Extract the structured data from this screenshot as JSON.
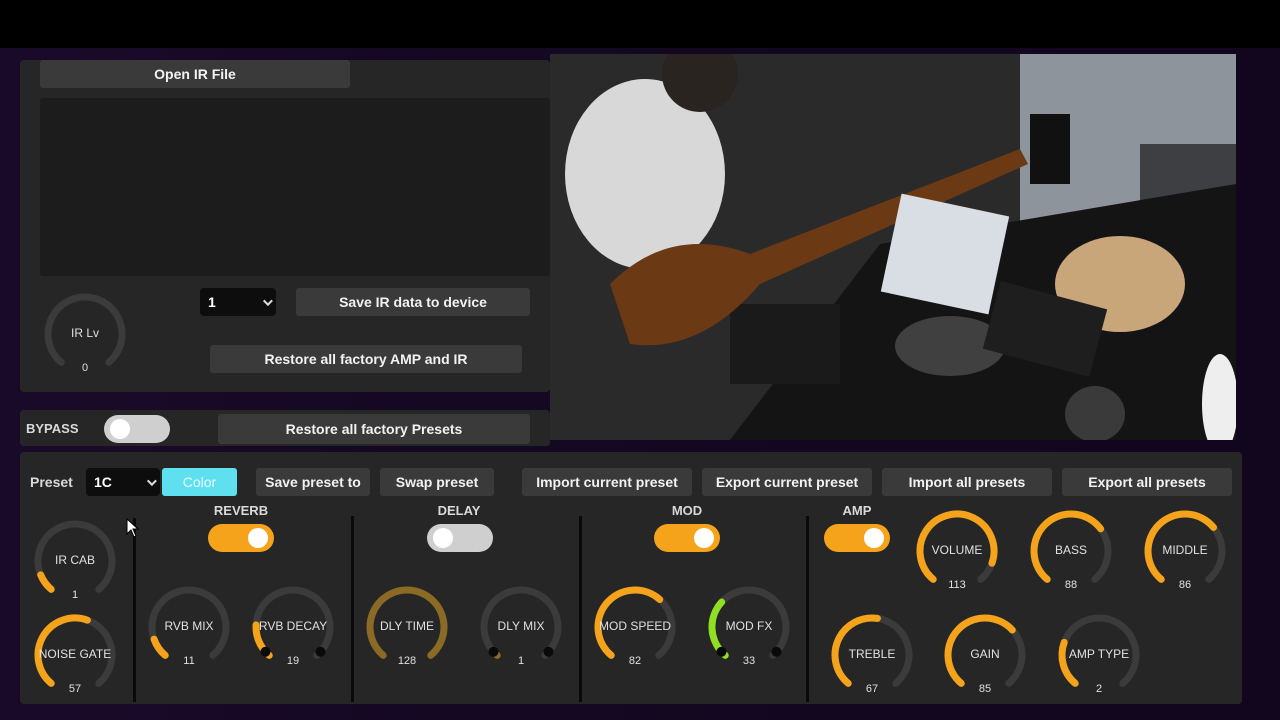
{
  "ir_panel": {
    "open_ir_file": "Open IR File",
    "ir_lv_label": "IR Lv",
    "ir_lv_value": "0",
    "ir_lv_level": 0,
    "slot_select": "1",
    "save_ir": "Save IR data to device",
    "restore_amp_ir": "Restore all factory AMP and IR"
  },
  "bypass": {
    "label": "BYPASS",
    "on": false,
    "restore_presets": "Restore all factory Presets"
  },
  "toolbar": {
    "preset_label": "Preset",
    "preset_value": "1C",
    "color_button": "Color",
    "save_preset": "Save preset to",
    "swap_preset": "Swap preset",
    "import_current": "Import current preset",
    "export_current": "Export current preset",
    "import_all": "Import all presets",
    "export_all": "Export all presets"
  },
  "sections": {
    "reverb": {
      "title": "REVERB",
      "on": true
    },
    "delay": {
      "title": "DELAY",
      "on": false
    },
    "mod": {
      "title": "MOD",
      "on": true
    },
    "amp": {
      "title": "AMP",
      "on": true
    }
  },
  "knobs": {
    "ir_cab": {
      "label": "IR CAB",
      "value": "1",
      "level": 0.1
    },
    "noise_gate": {
      "label": "NOISE GATE",
      "value": "57",
      "level": 0.57
    },
    "rvb_mix": {
      "label": "RVB MIX",
      "value": "11",
      "level": 0.11
    },
    "rvb_decay": {
      "label": "RVB DECAY",
      "value": "19",
      "level": 0.19
    },
    "dly_time": {
      "label": "DLY TIME",
      "value": "128",
      "level": 1.0
    },
    "dly_mix": {
      "label": "DLY MIX",
      "value": "1",
      "level": 0.02
    },
    "mod_speed": {
      "label": "MOD SPEED",
      "value": "82",
      "level": 0.65
    },
    "mod_fx": {
      "label": "MOD FX",
      "value": "33",
      "level": 0.33
    },
    "volume": {
      "label": "VOLUME",
      "value": "113",
      "level": 0.89
    },
    "bass": {
      "label": "BASS",
      "value": "88",
      "level": 0.69
    },
    "middle": {
      "label": "MIDDLE",
      "value": "86",
      "level": 0.68
    },
    "treble": {
      "label": "TREBLE",
      "value": "67",
      "level": 0.53
    },
    "gain": {
      "label": "GAIN",
      "value": "85",
      "level": 0.67
    },
    "amp_type": {
      "label": "AMP TYPE",
      "value": "2",
      "level": 0.25
    }
  },
  "colors": {
    "accent": "#f5a31a",
    "delay_dim": "#8a6a24",
    "mod_fx": "#8fe020",
    "track": "#3b3b3b",
    "color_button": "#5fe0f0"
  }
}
